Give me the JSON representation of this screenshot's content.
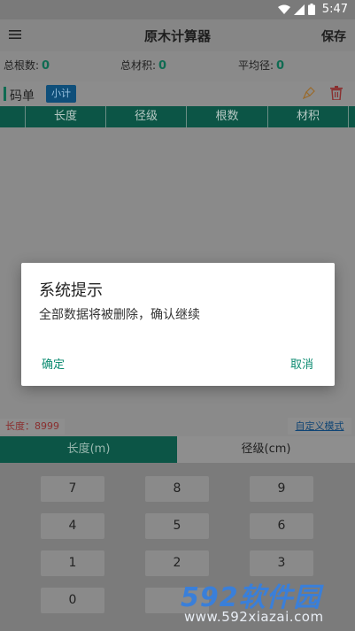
{
  "status_bar": {
    "time": "5:47"
  },
  "app_bar": {
    "menu_icon": "hamburger-menu-icon",
    "title": "原木计算器",
    "save_label": "保存"
  },
  "stats": [
    {
      "label": "总根数:",
      "value": "0"
    },
    {
      "label": "总材积:",
      "value": "0"
    },
    {
      "label": "平均径:",
      "value": "0"
    }
  ],
  "list": {
    "label": "码单",
    "subtotal_label": "小计"
  },
  "table": {
    "columns": [
      "长度",
      "径级",
      "根数",
      "材积"
    ]
  },
  "length_indicator": "长度：8999",
  "custom_mode_link": "自定义模式",
  "input_tabs": {
    "length": "长度(m)",
    "diameter": "径级(cm)"
  },
  "keypad": {
    "keys": [
      "7",
      "8",
      "9",
      "4",
      "5",
      "6",
      "1",
      "2",
      "3",
      "0"
    ]
  },
  "dialog": {
    "title": "系统提示",
    "message": "全部数据将被删除，确认继续",
    "ok_label": "确定",
    "cancel_label": "取消"
  },
  "watermark": {
    "logo_num": "592",
    "logo_cn": "软件园",
    "url": "www.592xiazai.com"
  }
}
